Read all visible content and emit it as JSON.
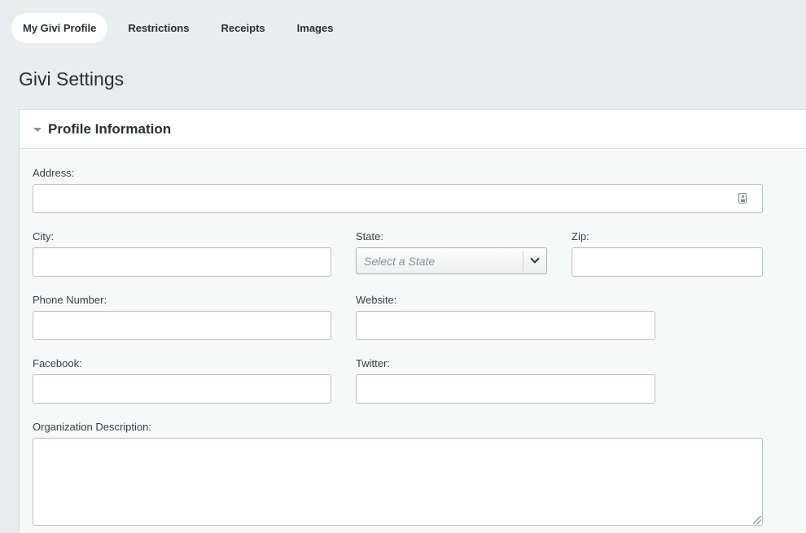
{
  "tabs": [
    {
      "label": "My Givi Profile",
      "active": true
    },
    {
      "label": "Restrictions",
      "active": false
    },
    {
      "label": "Receipts",
      "active": false
    },
    {
      "label": "Images",
      "active": false
    }
  ],
  "page": {
    "title": "Givi Settings"
  },
  "profile_section": {
    "title": "Profile Information",
    "expanded": true,
    "fields": {
      "address": {
        "label": "Address:",
        "value": ""
      },
      "city": {
        "label": "City:",
        "value": ""
      },
      "state": {
        "label": "State:",
        "placeholder": "Select a State"
      },
      "zip": {
        "label": "Zip:",
        "value": ""
      },
      "phone": {
        "label": "Phone Number:",
        "value": ""
      },
      "website": {
        "label": "Website:",
        "value": ""
      },
      "facebook": {
        "label": "Facebook:",
        "value": ""
      },
      "twitter": {
        "label": "Twitter:",
        "value": ""
      },
      "description": {
        "label": "Organization Description:",
        "value": ""
      }
    },
    "icons": {
      "address": "contact-card-icon",
      "state_dropdown": "chevron-down-icon",
      "toggle": "caret-down-icon"
    }
  },
  "colors": {
    "background": "#eaedee",
    "panel": "#f7f8f8",
    "header": "#ffffff",
    "border": "#b9bec2"
  }
}
